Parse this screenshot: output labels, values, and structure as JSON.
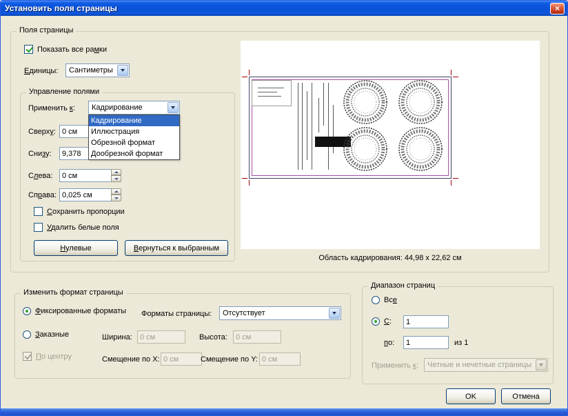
{
  "window": {
    "title": "Установить поля страницы"
  },
  "page_boxes": {
    "legend": "Поля страницы",
    "show_all_boxes_label": "Показать все ра&мки",
    "units_label": "&Единицы:",
    "units_value": "Сантиметры",
    "margin_controls": {
      "legend": "Управление полями",
      "apply_to_label": "Применить &к:",
      "apply_to_value": "Кадрирование",
      "options": [
        "Кадрирование",
        "Иллюстрация",
        "Обрезной формат",
        "Дообрезной формат"
      ],
      "top_label": "Сверх&у:",
      "top_value": "0 см",
      "bottom_label": "Сни&зу:",
      "bottom_value": "9,378",
      "left_label": "С&лева:",
      "left_value": "0 см",
      "right_label": "Сп&рава:",
      "right_value": "0,025 см",
      "constrain_label": "&Сохранить пропорции",
      "remove_white_label": "&Удалить белые поля",
      "zero_button": "&Нулевые",
      "revert_button": "&Вернуться к выбранным"
    },
    "crop_caption": "Область кадрирования: 44,98 x 22,62 см"
  },
  "page_size": {
    "legend": "Изменить формат страницы",
    "fixed_label": "&Фиксированные форматы",
    "sizes_label": "Форматы страницы:",
    "sizes_value": "Отсутствует",
    "custom_label": "&Заказные",
    "width_label": "Ширина:",
    "width_value": "0 см",
    "height_label": "Высота:",
    "height_value": "0 см",
    "center_label": "&По центру",
    "offset_x_label": "Смещение по X:",
    "offset_x_value": "0 см",
    "offset_y_label": "Смещение по Y:",
    "offset_y_value": "0 см"
  },
  "page_range": {
    "legend": "Диапазон страниц",
    "all_label": "Вс&е",
    "from_label": "&С:",
    "from_value": "1",
    "to_label": "&по:",
    "to_value": "1",
    "of_label": "из 1",
    "apply_to_label": "Применить &к:",
    "apply_to_value": "Четные и нечетные страницы"
  },
  "actions": {
    "ok": "OK",
    "cancel": "Отмена"
  }
}
